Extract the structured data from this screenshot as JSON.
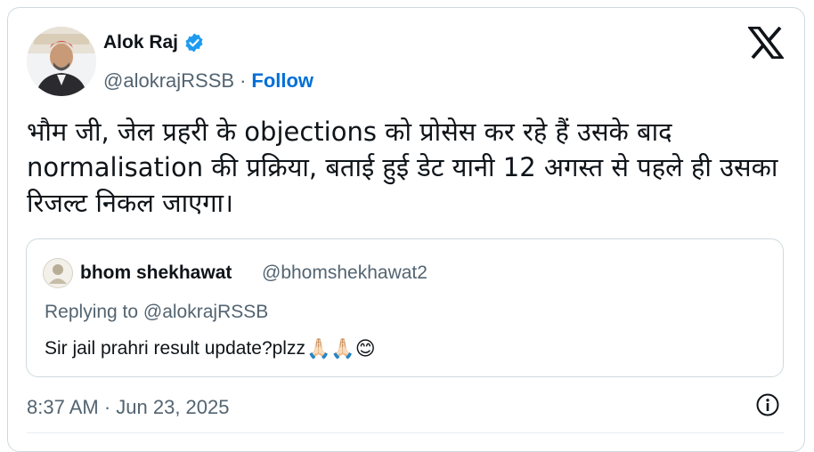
{
  "author": {
    "name": "Alok Raj",
    "handle": "@alokrajRSSB",
    "separator": "·",
    "follow_label": "Follow"
  },
  "tweet": {
    "text": "भौम जी, जेल प्रहरी के objections को प्रोसेस कर रहे हैं उसके बाद normalisation की प्रक्रिया, बताई हुई डेट यानी 12 अगस्त से पहले ही उसका रिजल्ट निकल जाएगा।",
    "timestamp": "8:37 AM · Jun 23, 2025"
  },
  "quoted": {
    "name": "bhom shekhawat",
    "handle": "@bhomshekhawat2",
    "reply_to": "Replying to @alokrajRSSB",
    "text": "Sir jail prahri result update?plzz",
    "emojis": "🙏🏻🙏🏻😊"
  },
  "icons": {
    "verified": "verified-badge-icon",
    "platform": "x-logo-icon",
    "info": "info-icon"
  },
  "colors": {
    "link": "#006fd6",
    "verified": "#1d9bf0",
    "muted": "#536471",
    "text": "#0f1419",
    "border": "#cfd9de"
  }
}
